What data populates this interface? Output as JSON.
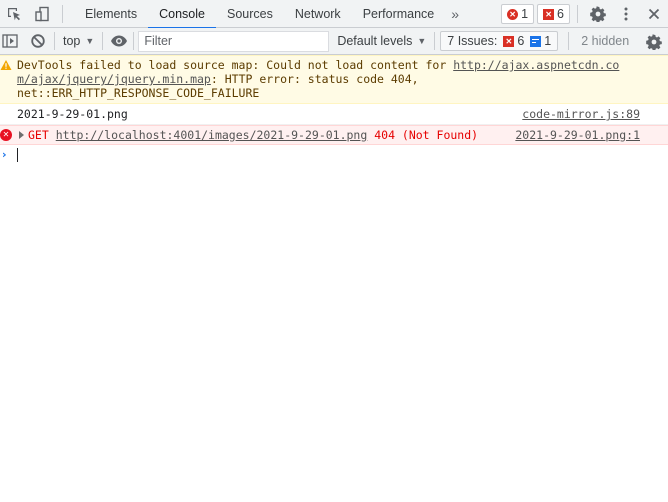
{
  "tabbar": {
    "tabs": [
      {
        "label": "Elements",
        "active": false
      },
      {
        "label": "Console",
        "active": true
      },
      {
        "label": "Sources",
        "active": false
      },
      {
        "label": "Network",
        "active": false
      },
      {
        "label": "Performance",
        "active": false
      }
    ],
    "more_tabs": "»",
    "error_count": "1",
    "issue_error_count": "6"
  },
  "toolbar": {
    "context": "top",
    "filter_placeholder": "Filter",
    "filter_value": "",
    "levels": "Default levels",
    "issues_label": "7 Issues:",
    "issues_errors": "6",
    "issues_info": "1",
    "hidden": "2 hidden"
  },
  "messages": {
    "warning": {
      "text_before": "DevTools failed to load source map: Could not load content for ",
      "url_line1": "http://ajax.aspnetcdn.co",
      "url_line2": "m/ajax/jquery/jquery.min.map",
      "text_after": ": HTTP error: status code 404,",
      "line3": "net::ERR_HTTP_RESPONSE_CODE_FAILURE"
    },
    "log": {
      "text": "2021-9-29-01.png",
      "source": "code-mirror.js:89"
    },
    "error": {
      "method": "GET",
      "url": "http://localhost:4001/images/2021-9-29-01.png",
      "status": "404 (Not Found)",
      "source": "2021-9-29-01.png:1"
    }
  },
  "colors": {
    "accent": "#1a73e8",
    "error": "#e60000",
    "warning_bg": "#fffbe5",
    "error_bg": "#fff0f0"
  }
}
